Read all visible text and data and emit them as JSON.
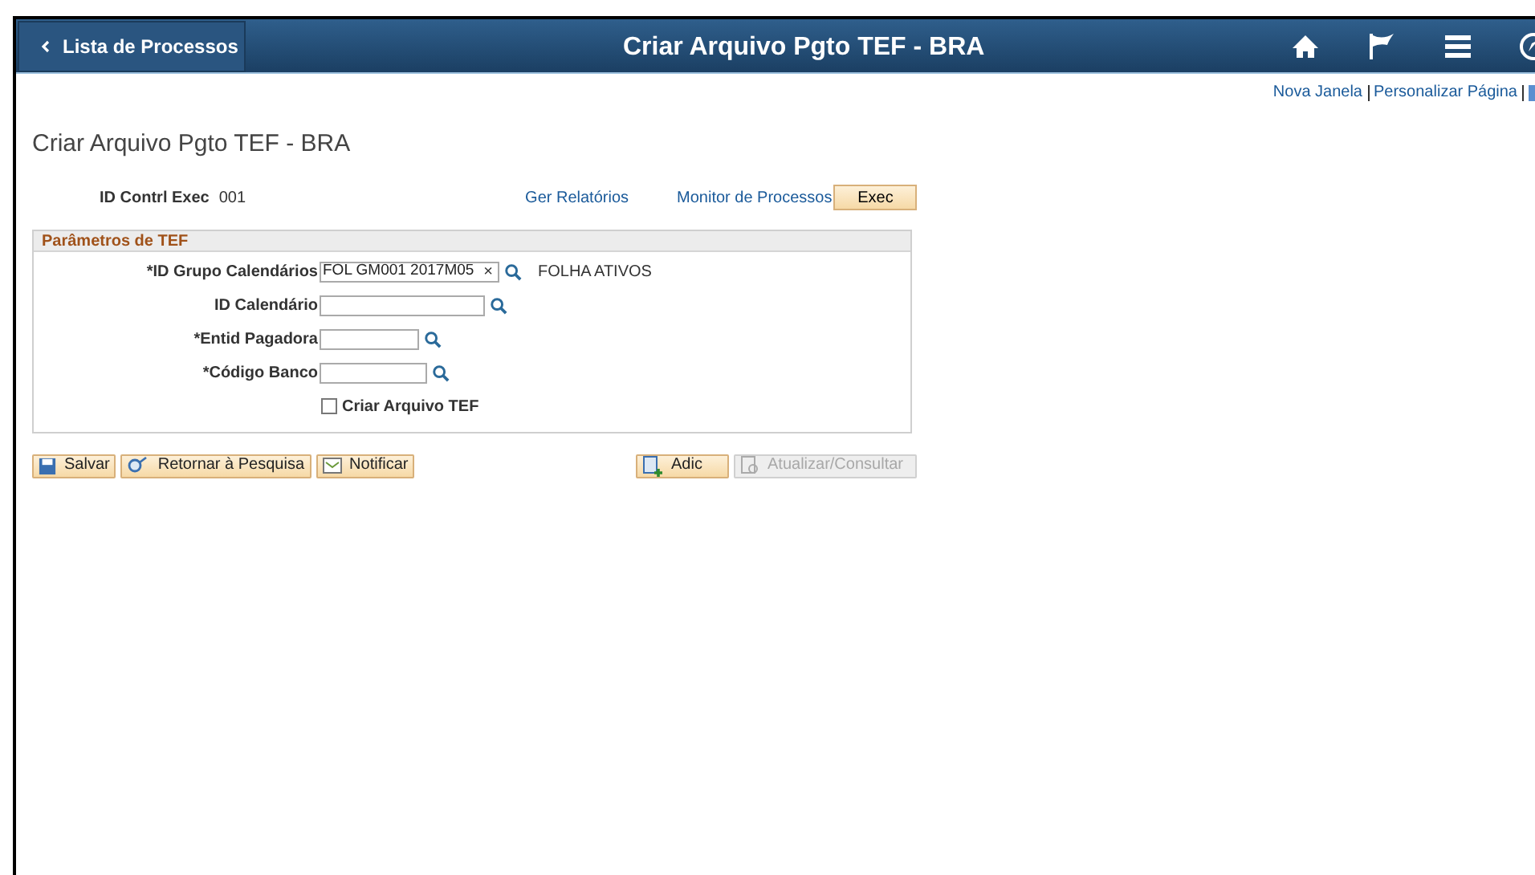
{
  "header": {
    "back_button": "Lista de Processos",
    "title": "Criar Arquivo Pgto TEF - BRA"
  },
  "top_links": [
    "Nova Janela",
    "Personalizar Página"
  ],
  "page_title": "Criar Arquivo Pgto TEF - BRA",
  "run_control": {
    "label": "ID Contrl Exec",
    "value": "001",
    "links": [
      "Ger Relatórios",
      "Monitor de Processos"
    ],
    "button": "Exec"
  },
  "panel": {
    "title": "Parâmetros de TEF",
    "fields": [
      {
        "kind": "lookup",
        "label": "*ID Grupo Calendários",
        "value": "FOL GM001 2017M05",
        "clear": "×",
        "description": "FOLHA ATIVOS"
      },
      {
        "kind": "lookup",
        "label": "ID Calendário"
      },
      {
        "kind": "lookup",
        "label": "*Entid Pagadora"
      },
      {
        "kind": "lookup",
        "label": "*Código Banco"
      },
      {
        "kind": "checkbox",
        "label": "Criar Arquivo TEF",
        "checked": false
      }
    ]
  },
  "buttons": [
    {
      "label": "Salvar",
      "disabled": false
    },
    {
      "label": "Retornar à Pesquisa",
      "disabled": false
    },
    {
      "label": "Notificar",
      "disabled": false
    }
  ],
  "right_buttons": [
    {
      "label": "Adic",
      "disabled": false
    },
    {
      "label": "Atualizar/Consultar",
      "disabled": true
    }
  ]
}
